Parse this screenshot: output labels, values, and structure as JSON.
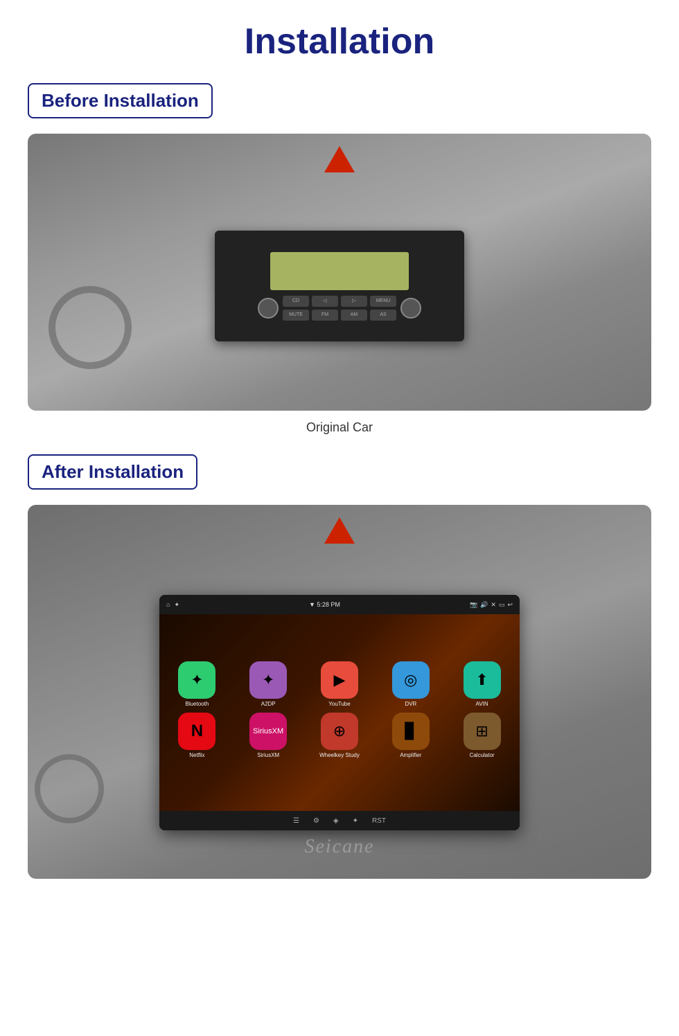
{
  "page": {
    "title": "Installation"
  },
  "before_section": {
    "badge_label": "Before Installation",
    "caption": "Original Car"
  },
  "after_section": {
    "badge_label": "After Installation"
  },
  "android_unit": {
    "status_bar": {
      "home_icon": "⌂",
      "wifi_icon": "✦",
      "time": "▼ 5:28 PM",
      "icons_right": "📷 🔊 ✕ ▭ ↩"
    },
    "apps_row1": [
      {
        "label": "Bluetooth",
        "icon": "✦",
        "class": "app-bluetooth"
      },
      {
        "label": "A2DP",
        "icon": "✦",
        "class": "app-a2dp"
      },
      {
        "label": "YouTube",
        "icon": "▶",
        "class": "app-youtube"
      },
      {
        "label": "DVR",
        "icon": "◎",
        "class": "app-dvr"
      },
      {
        "label": "AVIN",
        "icon": "⬆",
        "class": "app-avin"
      }
    ],
    "apps_row2": [
      {
        "label": "Netflix",
        "icon": "N",
        "class": "app-netflix"
      },
      {
        "label": "SiriusXM",
        "icon": "S",
        "class": "app-siriusxm"
      },
      {
        "label": "Wheelkey Study",
        "icon": "⊕",
        "class": "app-wheelkey"
      },
      {
        "label": "Amplifier",
        "icon": "▊",
        "class": "app-amplifier"
      },
      {
        "label": "Calculator",
        "icon": "⊞",
        "class": "app-calculator"
      }
    ]
  },
  "brand": "Seicane"
}
